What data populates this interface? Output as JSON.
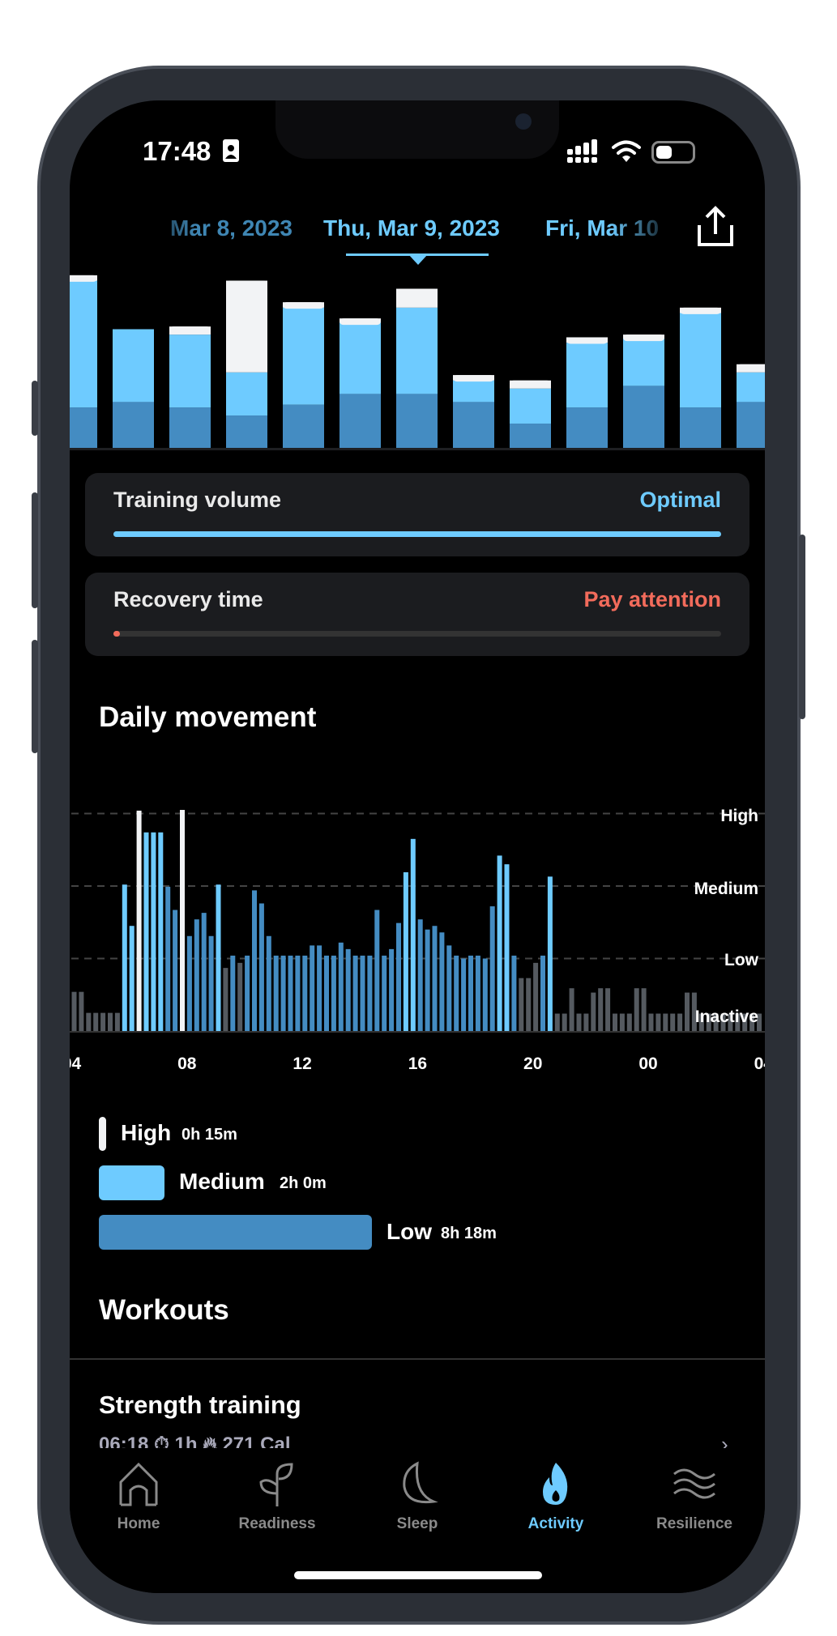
{
  "status": {
    "time": "17:48",
    "battery_level": 0.4
  },
  "dates": {
    "prev": "Mar 8, 2023",
    "current": "Thu, Mar 9, 2023",
    "next": "Fri, Mar 10"
  },
  "colors": {
    "low": "#448cc2",
    "medium": "#6ecbff",
    "high": "#f2f3f5",
    "inactive": "#555a60",
    "accent": "#6ecbff",
    "warning": "#f26b5b"
  },
  "weekly_chart": {
    "selected_index": 6,
    "bars": [
      {
        "low": 15,
        "medium": 47,
        "high": 2
      },
      {
        "low": 17,
        "medium": 27,
        "high": 0
      },
      {
        "low": 15,
        "medium": 27,
        "high": 3
      },
      {
        "low": 12,
        "medium": 16,
        "high": 34
      },
      {
        "low": 16,
        "medium": 36,
        "high": 2
      },
      {
        "low": 20,
        "medium": 27,
        "high": 1
      },
      {
        "low": 20,
        "medium": 32,
        "high": 7
      },
      {
        "low": 17,
        "medium": 8,
        "high": 2
      },
      {
        "low": 9,
        "medium": 13,
        "high": 3
      },
      {
        "low": 15,
        "medium": 24,
        "high": 2
      },
      {
        "low": 23,
        "medium": 18,
        "high": 1
      },
      {
        "low": 15,
        "medium": 35,
        "high": 2
      },
      {
        "low": 17,
        "medium": 11,
        "high": 3
      }
    ]
  },
  "training_volume": {
    "label": "Training volume",
    "status": "Optimal",
    "level": 1.0
  },
  "recovery_time": {
    "label": "Recovery time",
    "status": "Pay attention",
    "level": 0.01
  },
  "daily_movement": {
    "title": "Daily movement",
    "chart_data": {
      "type": "bar",
      "x_ticks": [
        "04",
        "08",
        "12",
        "16",
        "20",
        "00",
        "04"
      ],
      "y_levels": [
        "Inactive",
        "Low",
        "Medium",
        "High"
      ],
      "bin_minutes": 15,
      "values": [
        0.54,
        0.54,
        0.25,
        0.25,
        0.25,
        0.25,
        0.25,
        2.02,
        1.45,
        3.04,
        2.74,
        2.74,
        2.74,
        1.99,
        1.67,
        3.05,
        1.31,
        1.54,
        1.63,
        1.31,
        2.02,
        0.87,
        1.04,
        0.94,
        1.04,
        1.94,
        1.76,
        1.31,
        1.04,
        1.04,
        1.04,
        1.04,
        1.04,
        1.18,
        1.18,
        1.04,
        1.04,
        1.22,
        1.13,
        1.04,
        1.04,
        1.04,
        1.67,
        1.04,
        1.13,
        1.49,
        2.19,
        2.65,
        1.54,
        1.4,
        1.45,
        1.36,
        1.18,
        1.04,
        1.0,
        1.04,
        1.04,
        1.0,
        1.72,
        2.42,
        2.3,
        1.04,
        0.73,
        0.73,
        0.94,
        1.04,
        2.13,
        0.24,
        0.24,
        0.59,
        0.24,
        0.24,
        0.53,
        0.59,
        0.59,
        0.24,
        0.24,
        0.24,
        0.59,
        0.59,
        0.24,
        0.24,
        0.24,
        0.24,
        0.24,
        0.53,
        0.53,
        0.24,
        0.24,
        0.24,
        0.24,
        0.24,
        0.24,
        0.24,
        0.24,
        0.24
      ],
      "levels": "IIIIIIIMMHMMMLLHLLLLMILILLLLLLLLLLLLLLLLLLLLLLMMLLLLLLLLLLLMMLIIILMIIIIIIIIIIIIIIIIIIIIIIIIIIIII"
    },
    "legend": [
      {
        "label": "High",
        "value": "0h 15m"
      },
      {
        "label": "Medium",
        "value": "2h 0m"
      },
      {
        "label": "Low",
        "value": "8h 18m"
      }
    ]
  },
  "workouts": {
    "title": "Workouts",
    "items": [
      {
        "name": "Strength training",
        "start": "06:18",
        "duration": "1h",
        "calories": "271 Cal"
      }
    ]
  },
  "tabs": [
    {
      "label": "Home",
      "icon": "home-icon"
    },
    {
      "label": "Readiness",
      "icon": "sprout-icon"
    },
    {
      "label": "Sleep",
      "icon": "moon-icon"
    },
    {
      "label": "Activity",
      "icon": "flame-icon",
      "active": true
    },
    {
      "label": "Resilience",
      "icon": "waves-icon"
    }
  ]
}
